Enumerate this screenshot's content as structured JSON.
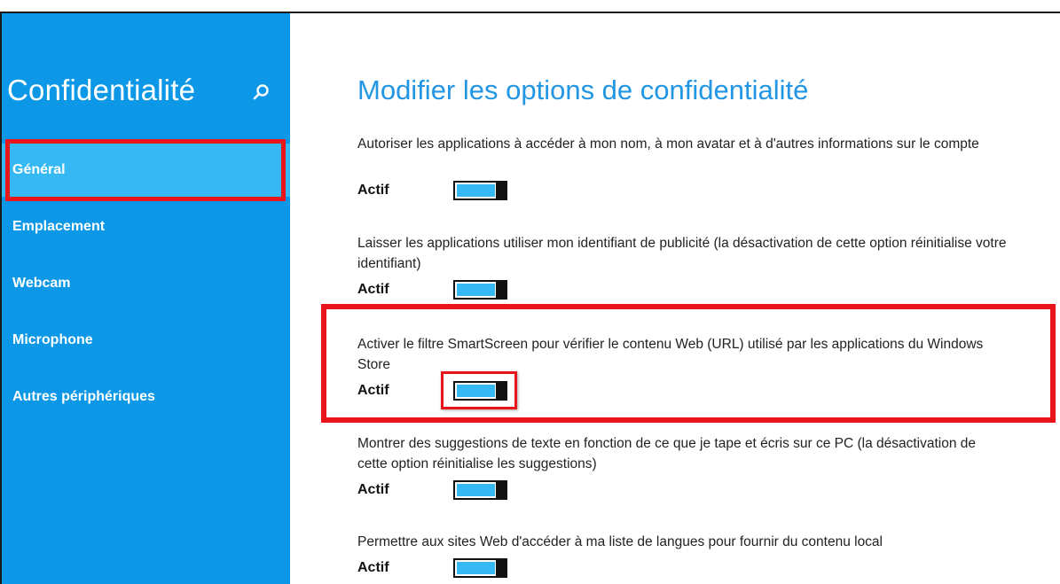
{
  "sidebar": {
    "title": "Confidentialité",
    "items": [
      {
        "label": "Général",
        "selected": true
      },
      {
        "label": "Emplacement",
        "selected": false
      },
      {
        "label": "Webcam",
        "selected": false
      },
      {
        "label": "Microphone",
        "selected": false
      },
      {
        "label": "Autres périphériques",
        "selected": false
      }
    ]
  },
  "main": {
    "title": "Modifier les options de confidentialité",
    "settings": [
      {
        "description": "Autoriser les applications à accéder à mon nom, à mon avatar et à d'autres informations sur le compte",
        "state": "Actif",
        "on": true
      },
      {
        "description": "Laisser les applications utiliser mon identifiant de publicité (la désactivation de cette option réinitialise votre identifiant)",
        "state": "Actif",
        "on": true
      },
      {
        "description": "Activer le filtre SmartScreen pour vérifier le contenu Web (URL) utilisé par les applications du Windows Store",
        "state": "Actif",
        "on": true
      },
      {
        "description": "Montrer des suggestions de texte en fonction de ce que je tape et écris sur ce PC (la désactivation de cette option réinitialise les suggestions)",
        "state": "Actif",
        "on": true
      },
      {
        "description": "Permettre aux sites Web d'accéder à ma liste de langues pour fournir du contenu local",
        "state": "Actif",
        "on": true
      }
    ]
  },
  "icons": {
    "search": "search-icon"
  },
  "colors": {
    "sidebar_bg": "#0c98e6",
    "selected_item_bg": "#36b8f2",
    "title_blue": "#2196e4",
    "toggle_fill": "#36b8f2",
    "highlight_red": "#e8151b"
  }
}
